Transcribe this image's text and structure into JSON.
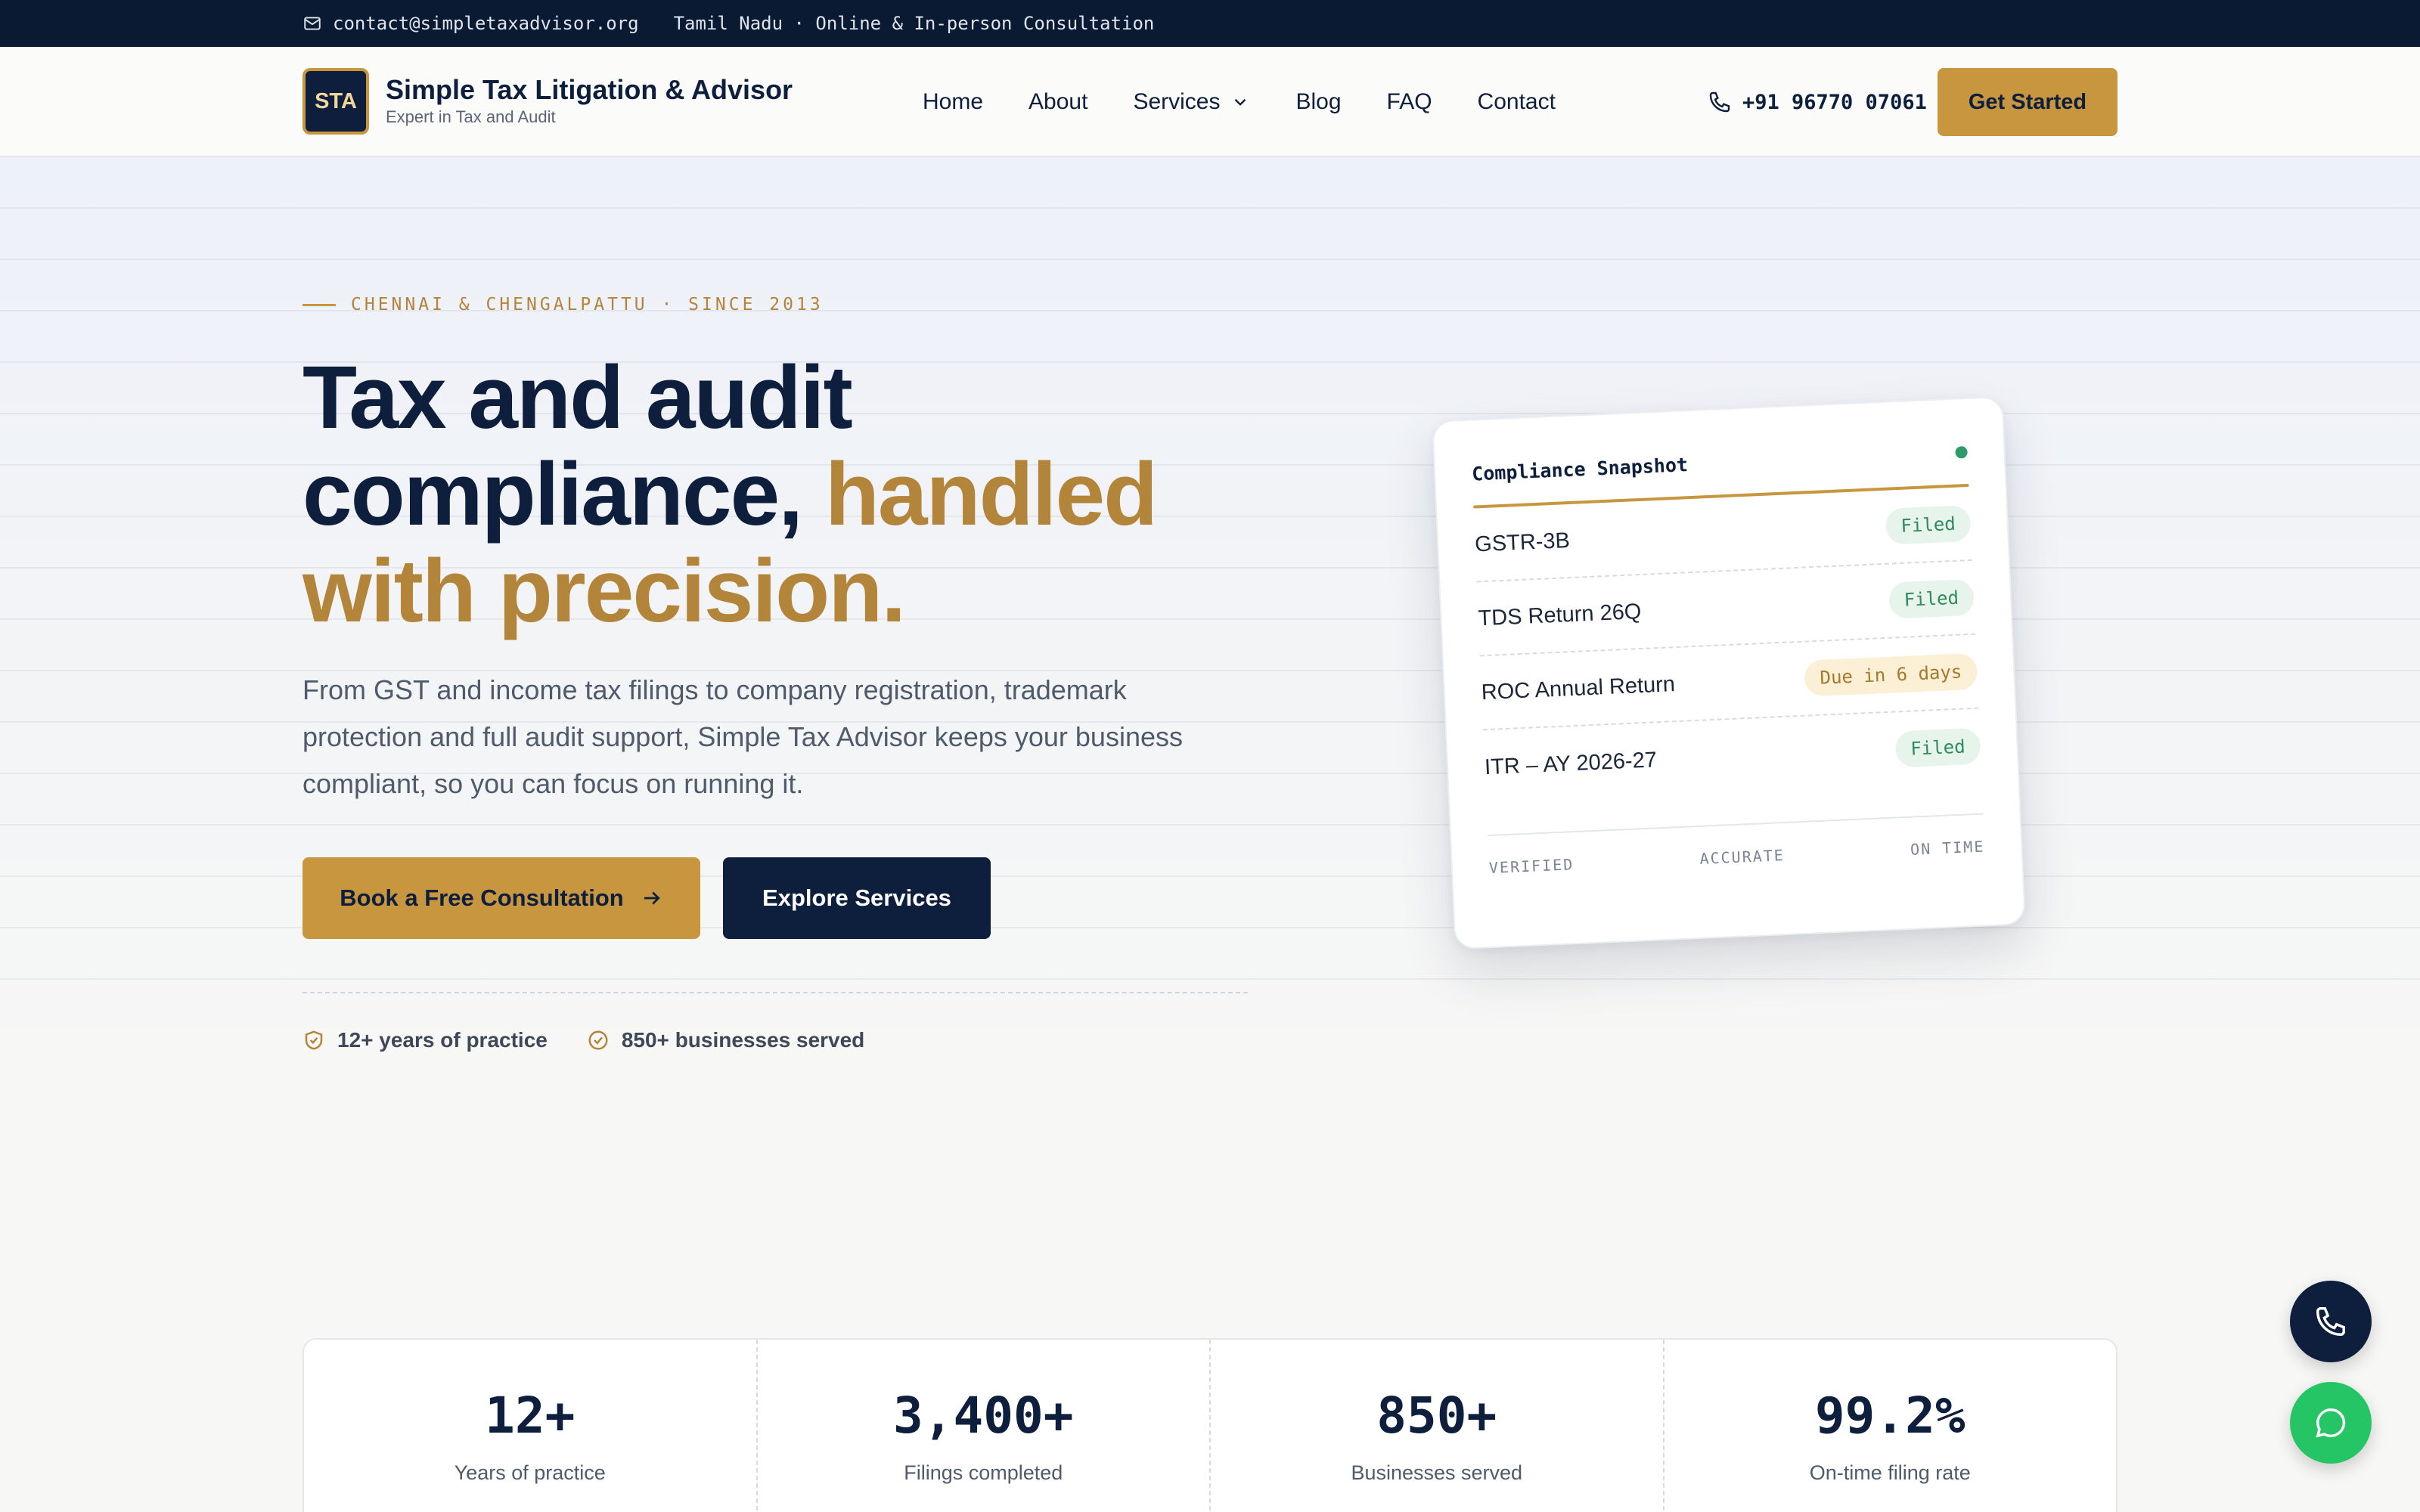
{
  "topbar": {
    "email": "contact@simpletaxadvisor.org",
    "region": "Tamil Nadu · Online & In-person Consultation"
  },
  "brand": {
    "logo_text": "STA",
    "name": "Simple Tax Litigation & Advisor",
    "tagline": "Expert in Tax and Audit"
  },
  "nav": {
    "items": [
      {
        "label": "Home"
      },
      {
        "label": "About"
      },
      {
        "label": "Services"
      },
      {
        "label": "Blog"
      },
      {
        "label": "FAQ"
      },
      {
        "label": "Contact"
      }
    ]
  },
  "header": {
    "phone": "+91 96770 07061",
    "cta": "Get Started"
  },
  "hero": {
    "eyebrow": "CHENNAI & CHENGALPATTU · SINCE 2013",
    "title_line1": "Tax and audit",
    "title_line2": "compliance,",
    "title_accent1": "handled",
    "title_accent2": "with precision.",
    "lede": "From GST and income tax filings to company registration, trademark protection and full audit support, Simple Tax Advisor keeps your business compliant, so you can focus on running it.",
    "primary_cta": "Book a Free Consultation",
    "secondary_cta": "Explore Services",
    "trust": [
      {
        "label": "12+ years of practice"
      },
      {
        "label": "850+ businesses served"
      }
    ]
  },
  "snapshot": {
    "title": "Compliance Snapshot",
    "status_color": "#2f9a6a",
    "rows": [
      {
        "label": "GSTR-3B",
        "status": "Filed"
      },
      {
        "label": "TDS Return 26Q",
        "status": "Filed"
      },
      {
        "label": "ROC Annual Return",
        "status": "Due in 6 days"
      },
      {
        "label": "ITR – AY 2026-27",
        "status": "Filed"
      }
    ],
    "footer": [
      "VERIFIED",
      "ACCURATE",
      "ON TIME"
    ]
  },
  "stats": [
    {
      "value": "12+",
      "label": "Years of practice"
    },
    {
      "value": "3,400+",
      "label": "Filings completed"
    },
    {
      "value": "850+",
      "label": "Businesses served"
    },
    {
      "value": "99.2%",
      "label": "On-time filing rate"
    }
  ],
  "colors": {
    "navy": "#0d1f3c",
    "gold": "#c8963e",
    "whatsapp": "#25c565"
  }
}
